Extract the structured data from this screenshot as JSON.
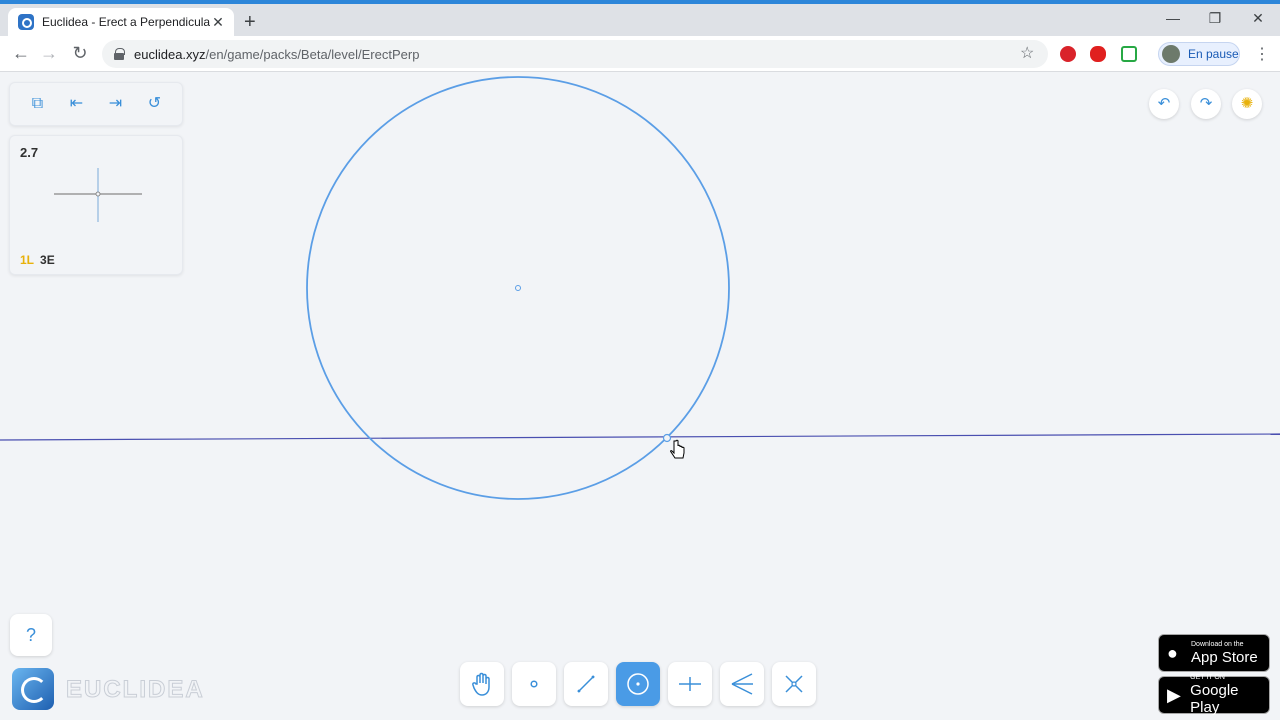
{
  "browser": {
    "tab_title": "Euclidea - Erect a Perpendicular",
    "tab_close": "✕",
    "new_tab": "+",
    "minimize": "—",
    "restore": "❐",
    "close": "✕",
    "url_host": "euclidea.xyz",
    "url_path": "/en/game/packs/Beta/level/ErectPerp",
    "profile_label": "En pause",
    "back": "←",
    "forward": "→",
    "reload": "↻",
    "bookmark": "☆",
    "menu": "⋮"
  },
  "level": {
    "number": "2.7",
    "score_l": "1L",
    "score_e": "3E"
  },
  "controls": {
    "packs": "⧉",
    "prev_level": "⇤",
    "next_level": "⇥",
    "restart": "↺",
    "undo": "↶",
    "redo": "↷",
    "settings": "✺",
    "help": "?"
  },
  "logo_text": "EUCLIDEA",
  "tools": [
    {
      "name": "move-tool",
      "icon": "hand-icon",
      "active": false
    },
    {
      "name": "point-tool",
      "icon": "point-icon",
      "active": false
    },
    {
      "name": "line-tool",
      "icon": "line-icon",
      "active": false
    },
    {
      "name": "circle-tool",
      "icon": "circle-icon",
      "active": true
    },
    {
      "name": "perpendicular-tool",
      "icon": "perpendicular-icon",
      "active": false
    },
    {
      "name": "angle-bisector-tool",
      "icon": "angle-bisector-icon",
      "active": false
    },
    {
      "name": "intersect-tool",
      "icon": "intersect-icon",
      "active": false
    }
  ],
  "stores": {
    "apple_small": "Download on the",
    "apple_big": "App Store",
    "google_small": "GET IT ON",
    "google_big": "Google Play"
  },
  "colors": {
    "accent": "#3a8fd9",
    "circle": "#5b9ee6",
    "given_line": "#4a4fb0",
    "level_score_l": "#e8b10a"
  }
}
